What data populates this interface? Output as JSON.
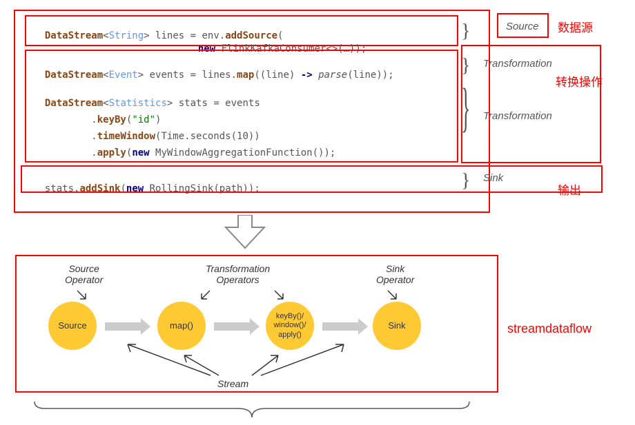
{
  "code": {
    "l1_a": "DataStream",
    "l1_b": "String",
    "l1_c": "> lines = env.",
    "l1_d": "addSource",
    "l1_e": "(",
    "l2_a": "new",
    "l2_b": " FlinkKafkaConsumer<>(…));",
    "l3_a": "DataStream",
    "l3_b": "Event",
    "l3_c": "> events = lines.",
    "l3_d": "map",
    "l3_e": "((line) ",
    "l3_f": "->",
    "l3_g": " parse",
    "l3_h": "(line));",
    "l4_a": "DataStream",
    "l4_b": "Statistics",
    "l4_c": "> stats = events",
    "l5_a": "        .",
    "l5_b": "keyBy",
    "l5_c": "(",
    "l5_d": "\"id\"",
    "l5_e": ")",
    "l6_a": "        .",
    "l6_b": "timeWindow",
    "l6_c": "(Time.seconds(10))",
    "l7_a": "        .",
    "l7_b": "apply",
    "l7_c": "(",
    "l7_d": "new",
    "l7_e": " MyWindowAggregationFunction());",
    "l8_a": "stats.",
    "l8_b": "addSink",
    "l8_c": "(",
    "l8_d": "new",
    "l8_e": " RollingSink(path));"
  },
  "stages": {
    "source": "Source",
    "trans1": "Transformation",
    "trans2": "Transformation",
    "sink": "Sink"
  },
  "cn": {
    "source": "数据源",
    "trans": "转换操作",
    "sink": "输出",
    "flow": "streamdataflow"
  },
  "flow": {
    "srcOp": "Source\nOperator",
    "transOp": "Transformation\nOperators",
    "sinkOp": "Sink\nOperator",
    "stream": "Stream",
    "n1": "Source",
    "n2": "map()",
    "n3": "keyBy()/\nwindow()/\napply()",
    "n4": "Sink"
  }
}
